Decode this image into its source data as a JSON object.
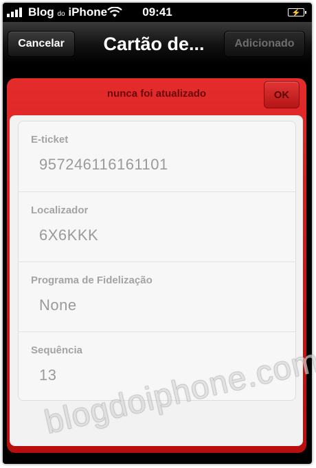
{
  "status_bar": {
    "carrier": "Blog",
    "carrier_small": "do",
    "carrier_end": "iPhone",
    "time": "09:41",
    "icons": [
      "signal-bars-icon",
      "wifi-icon",
      "battery-charging-icon"
    ]
  },
  "nav": {
    "cancel_label": "Cancelar",
    "title": "Cartão de...",
    "add_label": "Adicionado"
  },
  "card": {
    "status_text": "nunca foi atualizado",
    "ok_label": "OK",
    "accent_color": "#d91f1f",
    "fields": [
      {
        "label": "E-ticket",
        "value": "957246116161101"
      },
      {
        "label": "Localizador",
        "value": "6X6KKK"
      },
      {
        "label": "Programa de Fidelização",
        "value": "None"
      },
      {
        "label": "Sequência",
        "value": "13"
      }
    ]
  },
  "watermark": "blogdoiphone.com"
}
